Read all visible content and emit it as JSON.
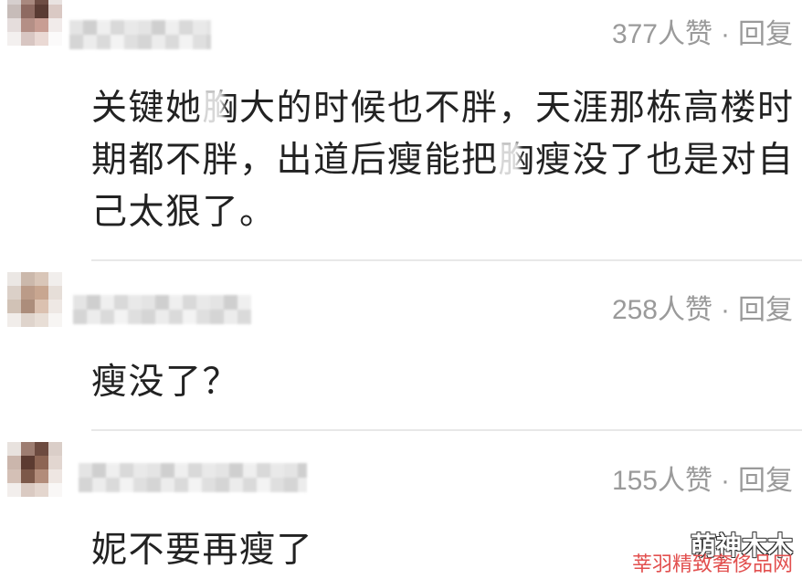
{
  "comments": [
    {
      "likes": "377人赞",
      "separator": "·",
      "reply_label": "回复",
      "text_lines": [
        [
          "关键她",
          "胸",
          "大的时候也不胖，天涯那栋高楼时"
        ],
        [
          "期都不胖，出道后瘦能把",
          "胸",
          "瘦没了也是对自"
        ],
        [
          "己太狠了。"
        ]
      ]
    },
    {
      "likes": "258人赞",
      "separator": "·",
      "reply_label": "回复",
      "text_lines": [
        [
          "瘦没了？"
        ]
      ]
    },
    {
      "likes": "155人赞",
      "separator": "·",
      "reply_label": "回复",
      "text_lines": [
        [
          "妮不要再瘦了"
        ]
      ]
    }
  ],
  "watermark": {
    "author": "萌神木木",
    "site": "莘羽精致奢侈品网"
  },
  "colors": {
    "text": "#222222",
    "meta": "#9a9a9a",
    "divider": "#e8e8e8",
    "watermark_site": "#e2504f",
    "background": "#ffffff"
  }
}
